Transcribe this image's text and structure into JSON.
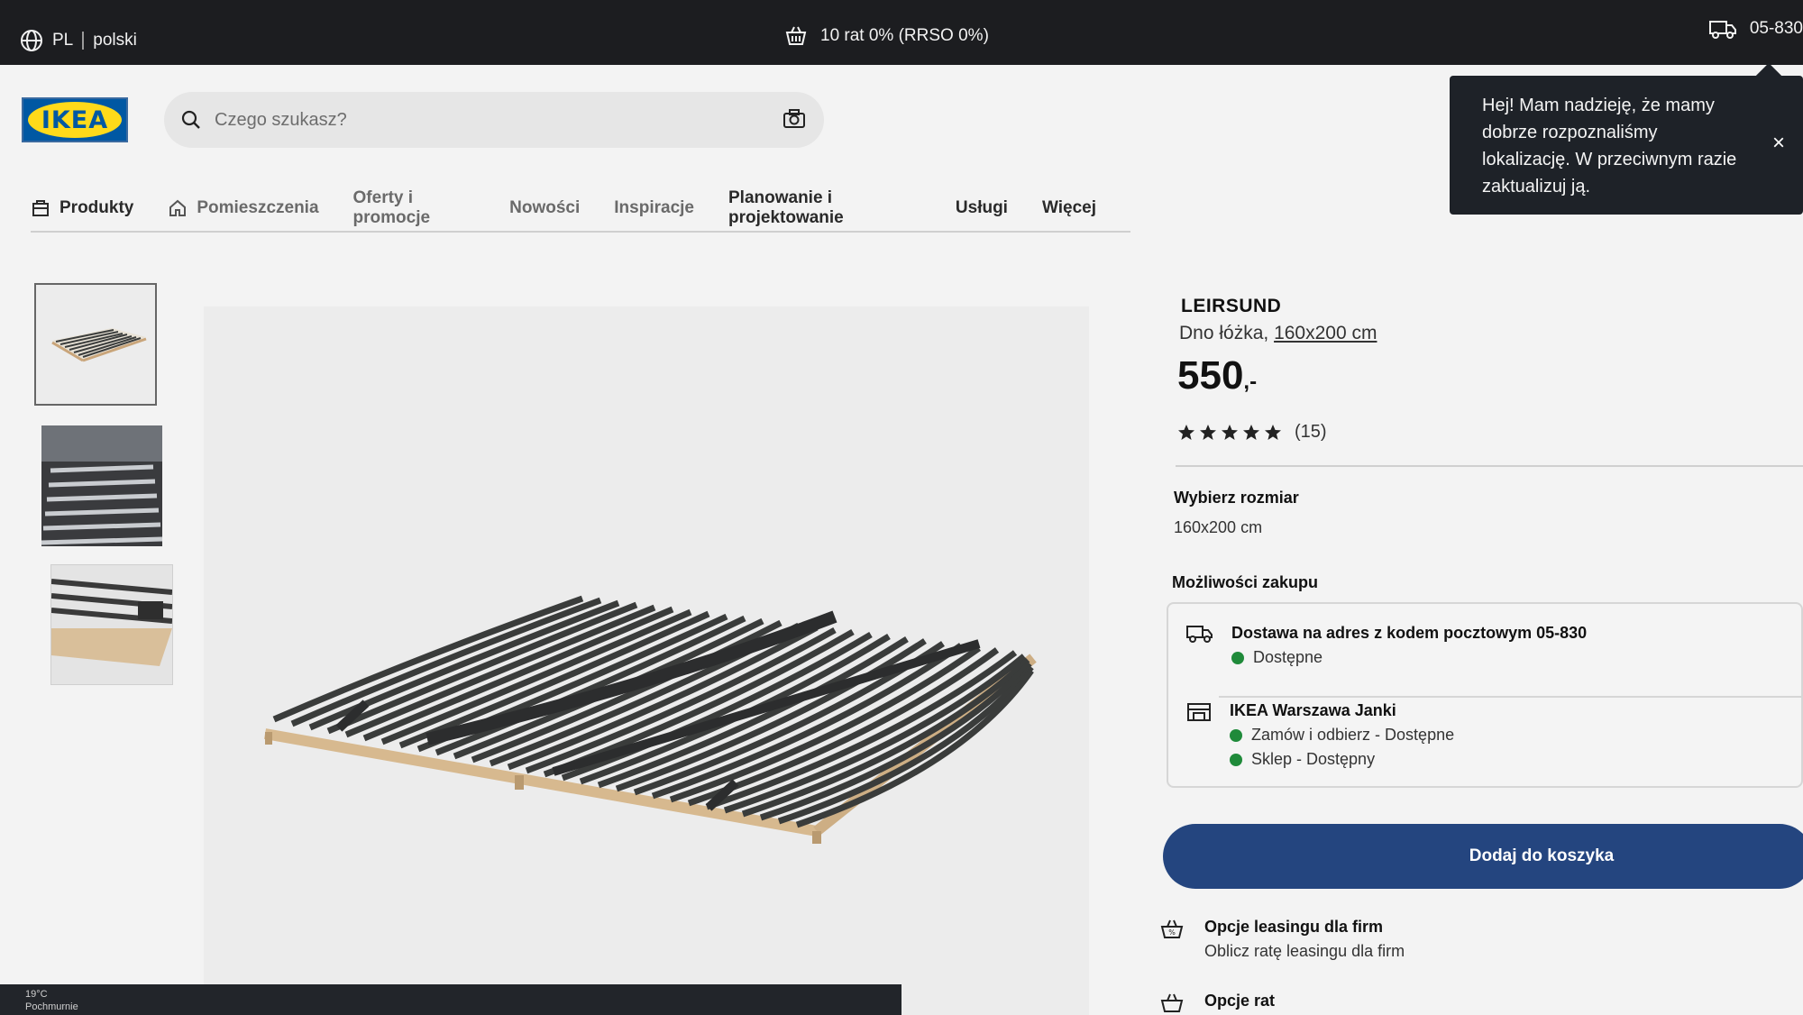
{
  "topbar": {
    "lang_code": "PL",
    "lang_name": "polski",
    "promo": "10 rat 0% (RRSO 0%)",
    "zip": "05-830"
  },
  "header": {
    "logo_text": "IKEA",
    "search_placeholder": "Czego szukasz?"
  },
  "nav": {
    "items": [
      "Produkty",
      "Pomieszczenia",
      "Oferty i promocje",
      "Nowości",
      "Inspiracje",
      "Planowanie i projektowanie",
      "Usługi",
      "Więcej"
    ]
  },
  "tooltip": {
    "text": "Hej! Mam nadzieję, że mamy dobrze rozpoznaliśmy lokalizację. W przeciwnym razie zaktualizuj ją.",
    "close": "×"
  },
  "product": {
    "name": "LEIRSUND",
    "desc_prefix": "Dno łóżka,",
    "desc_size": "160x200 cm",
    "price": "550",
    "price_suffix": ",-",
    "rating": 5,
    "reviews": "(15)"
  },
  "size": {
    "label": "Wybierz rozmiar",
    "value": "160x200 cm"
  },
  "purchase": {
    "label": "Możliwości zakupu",
    "delivery_title": "Dostawa na adres z kodem pocztowym 05-830",
    "delivery_status": "Dostępne",
    "store_title": "IKEA Warszawa Janki",
    "store_status1": "Zamów i odbierz - Dostępne",
    "store_status2": "Sklep - Dostępny"
  },
  "cart": {
    "button": "Dodaj do koszyka"
  },
  "leasing": {
    "title": "Opcje leasingu dla firm",
    "sub": "Oblicz ratę leasingu dla firm"
  },
  "installments": {
    "title": "Opcje rat"
  },
  "taskbar": {
    "temp": "19°C",
    "weather": "Pochmurnie"
  },
  "colors": {
    "topbar": "#1c1d20",
    "ikea_blue": "#0058a3",
    "ikea_yellow": "#ffda1a",
    "cart_button": "#24457f",
    "available_green": "#1f8a3a",
    "tooltip_bg": "#1e2228"
  }
}
